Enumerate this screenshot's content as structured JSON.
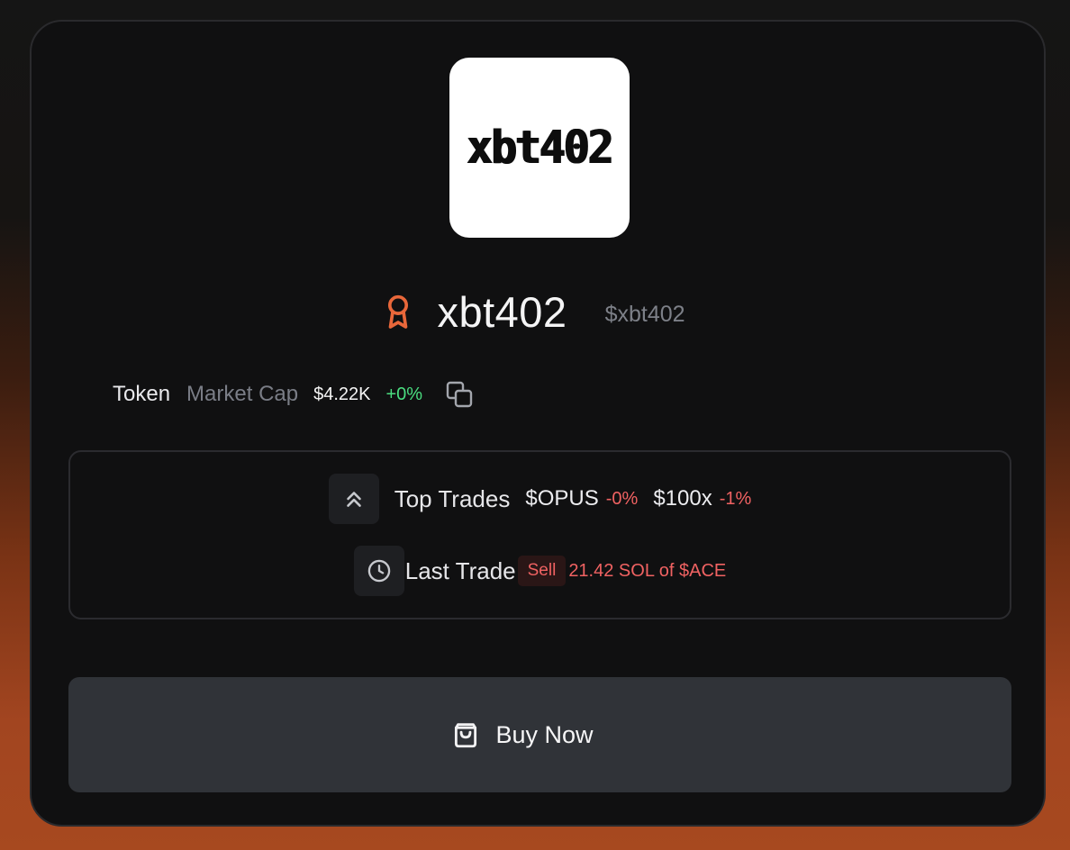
{
  "card": {
    "logo_text": "xbt402",
    "token_name": "xbt402",
    "ticker": "$xbt402",
    "token_label": "Token",
    "market_cap_label": "Market Cap",
    "market_cap_value": "$4.22K",
    "market_cap_change": "+0%"
  },
  "top_trades": {
    "label": "Top Trades",
    "items": [
      {
        "ticker": "$OPUS",
        "change": "-0%"
      },
      {
        "ticker": "$100x",
        "change": "-1%"
      }
    ]
  },
  "last_trade": {
    "label": "Last Trade",
    "side": "Sell",
    "detail": "21.42 SOL of $ACE"
  },
  "buy_button": {
    "label": "Buy Now"
  },
  "colors": {
    "accent_orange": "#e8673a",
    "positive": "#4ade80",
    "negative": "#f06262"
  },
  "icons": {
    "award": "award-icon",
    "copy": "copy-icon",
    "top_trades": "chevrons-up-icon",
    "last_trade": "clock-icon",
    "buy": "shopping-bag-icon"
  }
}
